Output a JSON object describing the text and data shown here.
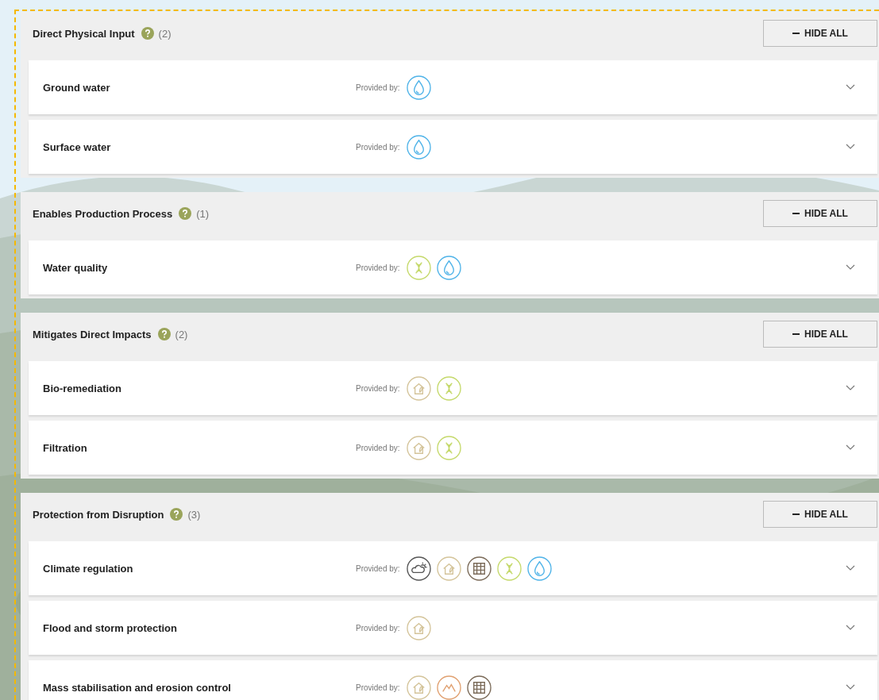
{
  "sections": [
    {
      "title": "Direct Physical Input",
      "count": "(2)",
      "button": "HIDE ALL",
      "items": [
        {
          "name": "Ground water",
          "provided_label": "Provided by:",
          "providers": [
            {
              "kind": "water"
            }
          ],
          "expanded": false
        },
        {
          "name": "Surface water",
          "provided_label": "Provided by:",
          "providers": [
            {
              "kind": "water"
            }
          ],
          "expanded": false
        }
      ]
    },
    {
      "title": "Enables Production Process",
      "count": "(1)",
      "button": "HIDE ALL",
      "items": [
        {
          "name": "Water quality",
          "provided_label": "Provided by:",
          "providers": [
            {
              "kind": "dna"
            },
            {
              "kind": "water"
            }
          ],
          "expanded": false
        }
      ]
    },
    {
      "title": "Mitigates Direct Impacts",
      "count": "(2)",
      "button": "HIDE ALL",
      "items": [
        {
          "name": "Bio-remediation",
          "provided_label": "Provided by:",
          "providers": [
            {
              "kind": "house"
            },
            {
              "kind": "dna"
            }
          ],
          "expanded": false
        },
        {
          "name": "Filtration",
          "provided_label": "Provided by:",
          "providers": [
            {
              "kind": "house"
            },
            {
              "kind": "dna"
            }
          ],
          "expanded": false
        }
      ]
    },
    {
      "title": "Protection from Disruption",
      "count": "(3)",
      "button": "HIDE ALL",
      "items": [
        {
          "name": "Climate regulation",
          "provided_label": "Provided by:",
          "providers": [
            {
              "kind": "weather"
            },
            {
              "kind": "house"
            },
            {
              "kind": "soil"
            },
            {
              "kind": "dna"
            },
            {
              "kind": "water"
            }
          ],
          "expanded": false
        },
        {
          "name": "Flood and storm protection",
          "provided_label": "Provided by:",
          "providers": [
            {
              "kind": "house"
            }
          ],
          "expanded": false
        },
        {
          "name": "Mass stabilisation and erosion control",
          "provided_label": "Provided by:",
          "providers": [
            {
              "kind": "house"
            },
            {
              "kind": "mountain"
            },
            {
              "kind": "soil"
            }
          ],
          "expanded": false
        }
      ]
    }
  ]
}
